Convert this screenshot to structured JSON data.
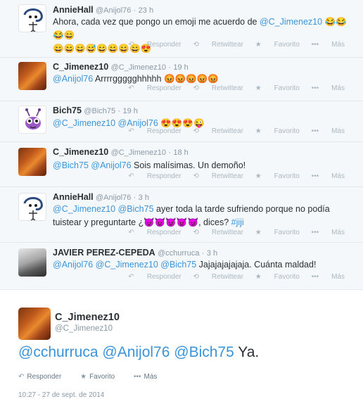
{
  "tweets": [
    {
      "name": "AnnieHall",
      "handle": "@Anijol76",
      "time": "23 h",
      "text_before": "Ahora, cada vez que pongo un emoji me acuerdo de ",
      "mention1": "@C_Jimenez10",
      "emoji_line1": "😂😂😂😄",
      "emoji_line2": "😄😄😄😅😄😄😄😄😍"
    },
    {
      "name": "C_Jimenez10",
      "handle": "@C_Jimenez10",
      "time": "19 h",
      "mention1": "@Anijol76",
      "text_after": " Arrrrggggghhhhh ",
      "emojis": "😡😡😡😡😡"
    },
    {
      "name": "Bich75",
      "handle": "@Bich75",
      "time": "19 h",
      "mention1": "@C_Jimenez10",
      "mention2": "@Anijol76",
      "emojis": "😍😍😍😜"
    },
    {
      "name": "C_Jimenez10",
      "handle": "@C_Jimenez10",
      "time": "18 h",
      "mention1": "@Bich75",
      "mention2": "@Anijol76",
      "text_after": " Sois malísimas. Un demoño!"
    },
    {
      "name": "AnnieHall",
      "handle": "@Anijol76",
      "time": "3 h",
      "mention1": "@C_Jimenez10",
      "mention2": "@Bich75",
      "text_a": " ayer toda la tarde sufriendo porque no podía tuistear y preguntarte ¿",
      "emojis": "😈😈😈😈😈",
      "text_b": ", dices? ",
      "hashtag": "#jiji"
    },
    {
      "name": "JAVIER PEREZ-CEPEDA",
      "handle": "@cchurruca",
      "time": "3 h",
      "mention1": "@Anijol76",
      "mention2": "@C_Jimenez10",
      "mention3": "@Bich75",
      "text_after": " Jajajajajajaja. Cuánta maldad!"
    }
  ],
  "actions": {
    "reply": "Responder",
    "retweet": "Retwittear",
    "favorite": "Favorito",
    "more": "Más"
  },
  "main_tweet": {
    "name": "C_Jimenez10",
    "handle": "@C_Jimenez10",
    "mention1": "@cchurruca",
    "mention2": "@Anijol76",
    "mention3": "@Bich75",
    "text_after": " Ya.",
    "timestamp": "10:27 - 27 de sept. de 2014"
  },
  "header_sep": "·",
  "colors": {
    "link": "#3b94d9",
    "text": "#292f33",
    "muted": "#8899a6",
    "conversation_bg": "#f5f8fa"
  },
  "icons": [
    "reply-icon",
    "retweet-icon",
    "favorite-star-icon",
    "more-dots-icon"
  ]
}
